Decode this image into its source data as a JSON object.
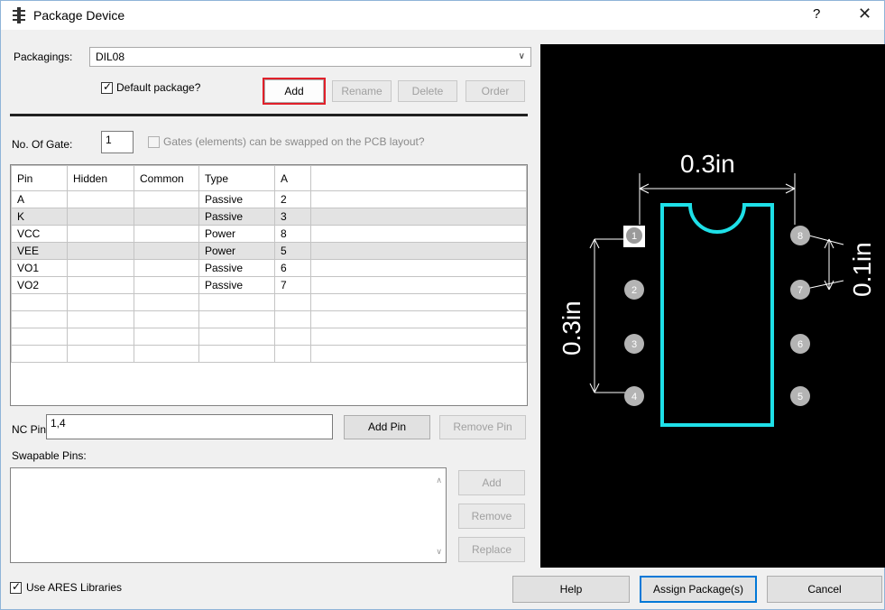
{
  "window": {
    "title": "Package Device",
    "help_label": "?",
    "close_label": "✕"
  },
  "packagings": {
    "label": "Packagings:",
    "value": "DIL08",
    "default_label": "Default package?",
    "default_checked": true
  },
  "package_buttons": {
    "add": "Add",
    "rename": "Rename",
    "delete": "Delete",
    "order": "Order"
  },
  "gates": {
    "label": "No. Of Gate:",
    "value": "1",
    "swap_label": "Gates (elements) can be swapped on the PCB layout?"
  },
  "pin_grid": {
    "columns": [
      "Pin",
      "Hidden",
      "Common",
      "Type",
      "A"
    ],
    "rows": [
      [
        "A",
        "",
        "",
        "Passive",
        "2"
      ],
      [
        "K",
        "",
        "",
        "Passive",
        "3"
      ],
      [
        "VCC",
        "",
        "",
        "Power",
        "8"
      ],
      [
        "VEE",
        "",
        "",
        "Power",
        "5"
      ],
      [
        "VO1",
        "",
        "",
        "Passive",
        "6"
      ],
      [
        "VO2",
        "",
        "",
        "Passive",
        "7"
      ],
      [
        "",
        "",
        "",
        "",
        ""
      ],
      [
        "",
        "",
        "",
        "",
        ""
      ],
      [
        "",
        "",
        "",
        "",
        ""
      ],
      [
        "",
        "",
        "",
        "",
        ""
      ]
    ]
  },
  "nc_pins": {
    "label": "NC Pins",
    "value": "1,4",
    "add_pin": "Add Pin",
    "remove_pin": "Remove Pin"
  },
  "swapable": {
    "label": "Swapable Pins:",
    "add": "Add",
    "remove": "Remove",
    "replace": "Replace"
  },
  "footer": {
    "ares_label": "Use ARES Libraries",
    "ares_checked": true,
    "help": "Help",
    "assign": "Assign Package(s)",
    "cancel": "Cancel"
  },
  "preview": {
    "dim_width": "0.3in",
    "dim_height": "0.3in",
    "dim_pitch": "0.1in",
    "left_pins": [
      "1",
      "2",
      "3",
      "4"
    ],
    "right_pins": [
      "8",
      "7",
      "6",
      "5"
    ],
    "colors": {
      "background": "#000000",
      "body_outline": "#1ee0e8",
      "dimension": "#ffffff",
      "pad": "#b4b4b4",
      "pin1_pad": "#ffffff"
    }
  }
}
